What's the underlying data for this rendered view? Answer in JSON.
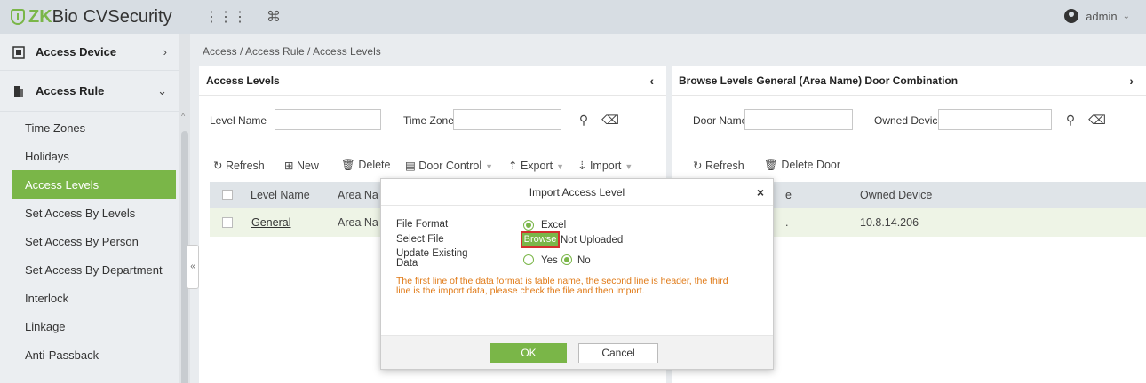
{
  "app": {
    "logo_zk": "ZK",
    "logo_bio": "Bio",
    "logo_rest": "CVSecurity",
    "grid_icon": "⋮⋮⋮",
    "cmd_icon": "⌘",
    "user": "admin"
  },
  "sidebar": {
    "groups": [
      {
        "label": "Access Device",
        "arrow": "›"
      },
      {
        "label": "Access Rule",
        "arrow": "⌄"
      }
    ],
    "items": [
      {
        "label": "Time Zones"
      },
      {
        "label": "Holidays"
      },
      {
        "label": "Access Levels"
      },
      {
        "label": "Set Access By Levels"
      },
      {
        "label": "Set Access By Person"
      },
      {
        "label": "Set Access By Department"
      },
      {
        "label": "Interlock"
      },
      {
        "label": "Linkage"
      },
      {
        "label": "Anti-Passback"
      }
    ],
    "collapse": "«"
  },
  "breadcrumb": "Access / Access Rule / Access Levels",
  "left_panel": {
    "title": "Access Levels",
    "caret": "‹",
    "filters": {
      "level_name": "Level Name",
      "time_zone": "Time Zone"
    },
    "toolbar": {
      "refresh": "Refresh",
      "new": "New",
      "delete": "Delete",
      "door_control": "Door Control",
      "export": "Export",
      "import": "Import"
    },
    "columns": [
      "Level Name",
      "Area Na"
    ],
    "rows": [
      {
        "level_name": "General",
        "area": "Area Na"
      }
    ]
  },
  "right_panel": {
    "title": "Browse Levels General  (Area Name) Door Combination",
    "caret": "›",
    "filters": {
      "door_name": "Door Name",
      "owned_device": "Owned Device"
    },
    "toolbar": {
      "refresh": "Refresh",
      "delete_door": "Delete Door"
    },
    "columns": [
      "e",
      "Owned Device"
    ],
    "rows": [
      {
        "door": ".",
        "owned_device": "10.8.14.206"
      }
    ]
  },
  "modal": {
    "title": "Import Access Level",
    "close": "×",
    "file_format_label": "File Format",
    "file_format_value": "Excel",
    "select_file_label": "Select File",
    "browse": "Browse",
    "upload_status": "Not Uploaded",
    "update_label_1": "Update Existing",
    "update_label_2": "Data",
    "yes": "Yes",
    "no": "No",
    "update_selected": "No",
    "hint_1": "The first line of the data format is table name, the second line is header, the third",
    "hint_2": "line is the import data, please check the file and then import.",
    "ok": "OK",
    "cancel": "Cancel"
  },
  "colors": {
    "accent": "#7ab648",
    "warning": "#e07a17",
    "highlight": "#d32f2f"
  }
}
